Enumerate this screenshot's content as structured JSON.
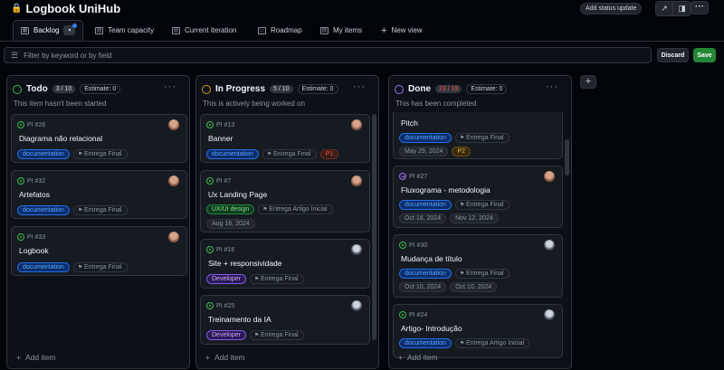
{
  "app": {
    "title": "Logbook UniHub"
  },
  "header": {
    "status_update": "Add status update"
  },
  "tabs": [
    {
      "label": "Backlog"
    },
    {
      "label": "Team capacity"
    },
    {
      "label": "Current iteration"
    },
    {
      "label": "Roadmap"
    },
    {
      "label": "My items"
    },
    {
      "label": "New view"
    }
  ],
  "filter": {
    "placeholder": "Filter by keyword or by field"
  },
  "actions": {
    "discard": "Discard",
    "save": "Save"
  },
  "columns": [
    {
      "name": "Todo",
      "count": "3 / 10",
      "estimate": "Estimate: 0",
      "description": "This item hasn't been started",
      "color": "#3fb950",
      "cards": [
        {
          "ref": "PI #26",
          "title": "Diagrama não relacional",
          "labels": [
            "documentation",
            "Entrega Final"
          ]
        },
        {
          "ref": "PI #32",
          "title": "Artefatos",
          "labels": [
            "documentation",
            "Entrega Final"
          ]
        },
        {
          "ref": "PI #33",
          "title": "Logbook",
          "labels": [
            "documentation",
            "Entrega Final"
          ]
        }
      ],
      "add_item": "Add item"
    },
    {
      "name": "In Progress",
      "count": "5 / 10",
      "estimate": "Estimate: 0",
      "description": "This is actively being worked on",
      "color": "#d29922",
      "cards": [
        {
          "ref": "PI #13",
          "title": "Banner",
          "labels": [
            "documentation",
            "Entrega Final",
            "P1"
          ]
        },
        {
          "ref": "PI #7",
          "title": "Ux Landing Page",
          "labels": [
            "UX/UI design",
            "Entrega Artigo Inicial",
            "Aug 16, 2024"
          ]
        },
        {
          "ref": "PI #16",
          "title": "Site + responsividade",
          "labels": [
            "Developer",
            "Entrega Final"
          ]
        },
        {
          "ref": "PI #25",
          "title": "Treinamento da IA",
          "labels": [
            "Developer",
            "Entrega Final"
          ]
        }
      ],
      "add_item": "Add item"
    },
    {
      "name": "Done",
      "count": "23 / 19",
      "estimate": "Estimate: 0",
      "description": "This has been completed",
      "color": "#a371f7",
      "cards": [
        {
          "ref": "",
          "title": "Pitch",
          "labels": [
            "documentation",
            "Entrega Final",
            "May 29, 2024",
            "P2"
          ]
        },
        {
          "ref": "PI #27",
          "title": "Fluxograma - metodologia",
          "labels": [
            "documentation",
            "Entrega Final",
            "Oct 18, 2024",
            "Nov 12, 2024"
          ]
        },
        {
          "ref": "PI #30",
          "title": "Mudança de título",
          "labels": [
            "documentation",
            "Entrega Final",
            "Oct 10, 2024",
            "Oct 10, 2024"
          ]
        },
        {
          "ref": "PI #24",
          "title": "Artigo- Introdução",
          "labels": [
            "documentation",
            "Entrega Artigo Inicial"
          ]
        }
      ],
      "add_item": "Add item"
    }
  ]
}
